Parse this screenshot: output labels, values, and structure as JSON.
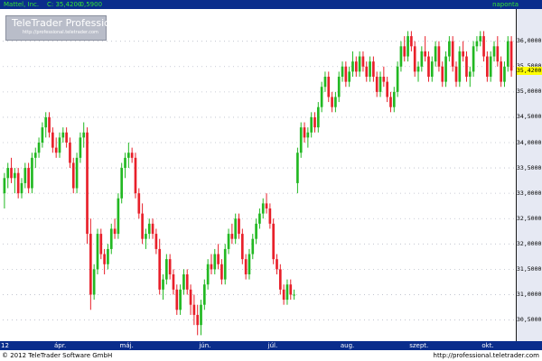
{
  "header": {
    "symbol": "Mattel, Inc.",
    "last": "C: 35,4200",
    "change": "-0,5900",
    "period": "naponta"
  },
  "logo": {
    "name": "TeleTrader Professional",
    "url": "http://professional.teletrader.com"
  },
  "footer": {
    "copyright": "© 2012 TeleTrader Software GmbH",
    "url": "http://professional.teletrader.com"
  },
  "colors": {
    "up": "#22b822",
    "down": "#e8202a",
    "doji": "#9ad6d6",
    "bar": "#0a2d8c",
    "axis_bg": "#e6e9f3",
    "grid": "#b9bdc9",
    "last_tag": "#ffff00"
  },
  "chart_data": {
    "type": "candlestick",
    "title": "Mattel, Inc.",
    "last_price_label": "35,4200",
    "y_axis": {
      "min": 30.1,
      "max": 36.6,
      "ticks": [
        30.5,
        31.0,
        31.5,
        32.0,
        32.5,
        33.0,
        33.5,
        34.0,
        34.5,
        35.0,
        35.5,
        36.0
      ],
      "tick_labels": [
        "30,5000",
        "31,0000",
        "31,5000",
        "32,0000",
        "32,5000",
        "33,0000",
        "33,5000",
        "34,0000",
        "34,5000",
        "35,0000",
        "35,5000",
        "36,0000"
      ]
    },
    "x_axis": {
      "labels": [
        "12",
        "ápr.",
        "máj.",
        "jún.",
        "júl.",
        "aug.",
        "szept.",
        "okt."
      ],
      "label_index": [
        0,
        16,
        35,
        58,
        78,
        99,
        119,
        140
      ]
    },
    "grid": true,
    "candles": [
      {
        "o": 33.0,
        "h": 33.4,
        "l": 32.7,
        "c": 33.3
      },
      {
        "o": 33.3,
        "h": 33.6,
        "l": 33.1,
        "c": 33.5
      },
      {
        "o": 33.5,
        "h": 33.7,
        "l": 33.2,
        "c": 33.3
      },
      {
        "o": 33.3,
        "h": 33.5,
        "l": 33.0,
        "c": 33.4
      },
      {
        "o": 33.4,
        "h": 33.5,
        "l": 32.9,
        "c": 33.0
      },
      {
        "o": 33.0,
        "h": 33.3,
        "l": 32.9,
        "c": 33.2
      },
      {
        "o": 33.2,
        "h": 33.6,
        "l": 33.1,
        "c": 33.5
      },
      {
        "o": 33.5,
        "h": 33.6,
        "l": 33.0,
        "c": 33.1
      },
      {
        "o": 33.1,
        "h": 33.8,
        "l": 33.0,
        "c": 33.7
      },
      {
        "o": 33.7,
        "h": 33.9,
        "l": 33.5,
        "c": 33.8
      },
      {
        "o": 33.8,
        "h": 34.1,
        "l": 33.7,
        "c": 34.0
      },
      {
        "o": 34.0,
        "h": 34.4,
        "l": 33.9,
        "c": 34.3
      },
      {
        "o": 34.3,
        "h": 34.6,
        "l": 34.1,
        "c": 34.5
      },
      {
        "o": 34.5,
        "h": 34.6,
        "l": 34.1,
        "c": 34.2
      },
      {
        "o": 34.2,
        "h": 34.3,
        "l": 33.8,
        "c": 33.9
      },
      {
        "o": 33.9,
        "h": 34.1,
        "l": 33.7,
        "c": 33.8
      },
      {
        "o": 33.8,
        "h": 34.2,
        "l": 33.7,
        "c": 34.1
      },
      {
        "o": 34.1,
        "h": 34.3,
        "l": 34.0,
        "c": 34.2
      },
      {
        "o": 34.2,
        "h": 34.3,
        "l": 33.9,
        "c": 34.0
      },
      {
        "o": 34.0,
        "h": 34.1,
        "l": 33.5,
        "c": 33.6
      },
      {
        "o": 33.6,
        "h": 33.7,
        "l": 33.0,
        "c": 33.1
      },
      {
        "o": 33.1,
        "h": 33.8,
        "l": 33.0,
        "c": 33.7
      },
      {
        "o": 33.7,
        "h": 34.2,
        "l": 33.6,
        "c": 34.1
      },
      {
        "o": 34.1,
        "h": 34.4,
        "l": 33.9,
        "c": 34.2
      },
      {
        "o": 34.2,
        "h": 34.3,
        "l": 32.0,
        "c": 32.2
      },
      {
        "o": 32.2,
        "h": 32.5,
        "l": 30.7,
        "c": 31.0
      },
      {
        "o": 31.0,
        "h": 31.6,
        "l": 30.9,
        "c": 31.5
      },
      {
        "o": 31.5,
        "h": 32.3,
        "l": 31.4,
        "c": 32.2
      },
      {
        "o": 32.2,
        "h": 32.3,
        "l": 31.7,
        "c": 31.8
      },
      {
        "o": 31.8,
        "h": 31.9,
        "l": 31.4,
        "c": 31.6
      },
      {
        "o": 31.6,
        "h": 32.0,
        "l": 31.5,
        "c": 31.9
      },
      {
        "o": 31.9,
        "h": 32.4,
        "l": 31.8,
        "c": 32.3
      },
      {
        "o": 32.3,
        "h": 32.5,
        "l": 32.1,
        "c": 32.2
      },
      {
        "o": 32.2,
        "h": 33.0,
        "l": 32.1,
        "c": 32.9
      },
      {
        "o": 32.9,
        "h": 33.6,
        "l": 32.8,
        "c": 33.5
      },
      {
        "o": 33.5,
        "h": 33.8,
        "l": 33.3,
        "c": 33.7
      },
      {
        "o": 33.7,
        "h": 34.0,
        "l": 33.5,
        "c": 33.8
      },
      {
        "o": 33.8,
        "h": 33.9,
        "l": 33.6,
        "c": 33.7
      },
      {
        "o": 33.7,
        "h": 33.8,
        "l": 32.9,
        "c": 33.0
      },
      {
        "o": 33.0,
        "h": 33.1,
        "l": 32.5,
        "c": 32.6
      },
      {
        "o": 32.6,
        "h": 32.8,
        "l": 32.0,
        "c": 32.1
      },
      {
        "o": 32.1,
        "h": 32.3,
        "l": 31.9,
        "c": 32.2
      },
      {
        "o": 32.2,
        "h": 32.5,
        "l": 32.1,
        "c": 32.4
      },
      {
        "o": 32.4,
        "h": 32.5,
        "l": 32.1,
        "c": 32.2
      },
      {
        "o": 32.2,
        "h": 32.3,
        "l": 31.8,
        "c": 31.9
      },
      {
        "o": 31.9,
        "h": 32.1,
        "l": 31.0,
        "c": 31.1
      },
      {
        "o": 31.1,
        "h": 31.4,
        "l": 30.9,
        "c": 31.3
      },
      {
        "o": 31.3,
        "h": 31.8,
        "l": 31.2,
        "c": 31.7
      },
      {
        "o": 31.7,
        "h": 31.8,
        "l": 31.3,
        "c": 31.4
      },
      {
        "o": 31.4,
        "h": 31.5,
        "l": 31.0,
        "c": 31.1
      },
      {
        "o": 31.1,
        "h": 31.2,
        "l": 30.6,
        "c": 30.7
      },
      {
        "o": 30.7,
        "h": 31.2,
        "l": 30.6,
        "c": 31.1
      },
      {
        "o": 31.1,
        "h": 31.5,
        "l": 31.0,
        "c": 31.4
      },
      {
        "o": 31.4,
        "h": 31.5,
        "l": 31.0,
        "c": 31.1
      },
      {
        "o": 31.1,
        "h": 31.2,
        "l": 30.6,
        "c": 30.8
      },
      {
        "o": 30.8,
        "h": 31.0,
        "l": 30.4,
        "c": 30.6
      },
      {
        "o": 30.6,
        "h": 30.8,
        "l": 30.2,
        "c": 30.4
      },
      {
        "o": 30.4,
        "h": 30.9,
        "l": 30.2,
        "c": 30.8
      },
      {
        "o": 30.8,
        "h": 31.3,
        "l": 30.7,
        "c": 31.2
      },
      {
        "o": 31.2,
        "h": 31.7,
        "l": 31.1,
        "c": 31.6
      },
      {
        "o": 31.6,
        "h": 31.8,
        "l": 31.4,
        "c": 31.5
      },
      {
        "o": 31.5,
        "h": 31.9,
        "l": 31.4,
        "c": 31.8
      },
      {
        "o": 31.8,
        "h": 32.0,
        "l": 31.5,
        "c": 31.6
      },
      {
        "o": 31.6,
        "h": 31.7,
        "l": 31.2,
        "c": 31.3
      },
      {
        "o": 31.3,
        "h": 32.0,
        "l": 31.2,
        "c": 31.9
      },
      {
        "o": 31.9,
        "h": 32.3,
        "l": 31.8,
        "c": 32.2
      },
      {
        "o": 32.2,
        "h": 32.4,
        "l": 32.0,
        "c": 32.1
      },
      {
        "o": 32.1,
        "h": 32.6,
        "l": 32.0,
        "c": 32.5
      },
      {
        "o": 32.5,
        "h": 32.6,
        "l": 32.1,
        "c": 32.2
      },
      {
        "o": 32.2,
        "h": 32.3,
        "l": 31.6,
        "c": 31.7
      },
      {
        "o": 31.7,
        "h": 31.8,
        "l": 31.3,
        "c": 31.4
      },
      {
        "o": 31.4,
        "h": 31.9,
        "l": 31.3,
        "c": 31.8
      },
      {
        "o": 31.8,
        "h": 32.2,
        "l": 31.7,
        "c": 32.1
      },
      {
        "o": 32.1,
        "h": 32.5,
        "l": 32.0,
        "c": 32.4
      },
      {
        "o": 32.4,
        "h": 32.7,
        "l": 32.3,
        "c": 32.6
      },
      {
        "o": 32.6,
        "h": 32.9,
        "l": 32.5,
        "c": 32.8
      },
      {
        "o": 32.8,
        "h": 33.0,
        "l": 32.6,
        "c": 32.7
      },
      {
        "o": 32.7,
        "h": 32.8,
        "l": 32.3,
        "c": 32.4
      },
      {
        "o": 32.4,
        "h": 32.5,
        "l": 31.6,
        "c": 31.7
      },
      {
        "o": 31.7,
        "h": 31.8,
        "l": 31.4,
        "c": 31.5
      },
      {
        "o": 31.5,
        "h": 31.6,
        "l": 31.0,
        "c": 31.1
      },
      {
        "o": 31.1,
        "h": 31.2,
        "l": 30.8,
        "c": 30.9
      },
      {
        "o": 30.9,
        "h": 31.3,
        "l": 30.8,
        "c": 31.2
      },
      {
        "o": 31.2,
        "h": 31.3,
        "l": 30.9,
        "c": 31.0
      },
      {
        "o": 31.0,
        "h": 31.1,
        "l": 30.9,
        "c": 31.0
      },
      {
        "o": 33.2,
        "h": 33.9,
        "l": 33.0,
        "c": 33.8
      },
      {
        "o": 33.8,
        "h": 34.4,
        "l": 33.7,
        "c": 34.3
      },
      {
        "o": 34.3,
        "h": 34.4,
        "l": 34.0,
        "c": 34.1
      },
      {
        "o": 34.1,
        "h": 34.3,
        "l": 33.9,
        "c": 34.2
      },
      {
        "o": 34.2,
        "h": 34.6,
        "l": 34.1,
        "c": 34.5
      },
      {
        "o": 34.5,
        "h": 34.6,
        "l": 34.2,
        "c": 34.3
      },
      {
        "o": 34.3,
        "h": 34.8,
        "l": 34.2,
        "c": 34.7
      },
      {
        "o": 34.7,
        "h": 35.2,
        "l": 34.6,
        "c": 35.1
      },
      {
        "o": 35.1,
        "h": 35.4,
        "l": 35.0,
        "c": 35.3
      },
      {
        "o": 35.3,
        "h": 35.4,
        "l": 34.8,
        "c": 34.9
      },
      {
        "o": 34.9,
        "h": 35.0,
        "l": 34.6,
        "c": 34.7
      },
      {
        "o": 34.7,
        "h": 35.0,
        "l": 34.6,
        "c": 34.9
      },
      {
        "o": 34.9,
        "h": 35.4,
        "l": 34.8,
        "c": 35.3
      },
      {
        "o": 35.3,
        "h": 35.6,
        "l": 35.2,
        "c": 35.5
      },
      {
        "o": 35.5,
        "h": 35.6,
        "l": 35.1,
        "c": 35.2
      },
      {
        "o": 35.2,
        "h": 35.5,
        "l": 35.1,
        "c": 35.4
      },
      {
        "o": 35.4,
        "h": 35.8,
        "l": 35.3,
        "c": 35.6
      },
      {
        "o": 35.6,
        "h": 35.7,
        "l": 35.3,
        "c": 35.4
      },
      {
        "o": 35.4,
        "h": 35.8,
        "l": 35.3,
        "c": 35.7
      },
      {
        "o": 35.7,
        "h": 35.8,
        "l": 35.4,
        "c": 35.5
      },
      {
        "o": 35.5,
        "h": 35.6,
        "l": 35.2,
        "c": 35.3
      },
      {
        "o": 35.3,
        "h": 35.7,
        "l": 35.2,
        "c": 35.6
      },
      {
        "o": 35.6,
        "h": 35.7,
        "l": 35.2,
        "c": 35.3
      },
      {
        "o": 35.3,
        "h": 35.4,
        "l": 34.9,
        "c": 35.0
      },
      {
        "o": 35.0,
        "h": 35.4,
        "l": 34.9,
        "c": 35.3
      },
      {
        "o": 35.3,
        "h": 35.5,
        "l": 35.1,
        "c": 35.2
      },
      {
        "o": 35.2,
        "h": 35.3,
        "l": 34.8,
        "c": 34.9
      },
      {
        "o": 34.9,
        "h": 35.0,
        "l": 34.6,
        "c": 34.7
      },
      {
        "o": 34.7,
        "h": 35.1,
        "l": 34.6,
        "c": 35.0
      },
      {
        "o": 35.0,
        "h": 35.6,
        "l": 34.9,
        "c": 35.5
      },
      {
        "o": 35.5,
        "h": 36.0,
        "l": 35.4,
        "c": 35.9
      },
      {
        "o": 35.9,
        "h": 36.1,
        "l": 35.6,
        "c": 35.7
      },
      {
        "o": 35.7,
        "h": 36.2,
        "l": 35.6,
        "c": 36.1
      },
      {
        "o": 36.1,
        "h": 36.2,
        "l": 35.8,
        "c": 35.9
      },
      {
        "o": 35.9,
        "h": 36.0,
        "l": 35.3,
        "c": 35.4
      },
      {
        "o": 35.4,
        "h": 35.6,
        "l": 35.2,
        "c": 35.5
      },
      {
        "o": 35.5,
        "h": 35.9,
        "l": 35.4,
        "c": 35.8
      },
      {
        "o": 35.8,
        "h": 36.1,
        "l": 35.6,
        "c": 35.7
      },
      {
        "o": 35.7,
        "h": 35.8,
        "l": 35.2,
        "c": 35.3
      },
      {
        "o": 35.3,
        "h": 35.7,
        "l": 35.2,
        "c": 35.6
      },
      {
        "o": 35.6,
        "h": 36.0,
        "l": 35.5,
        "c": 35.9
      },
      {
        "o": 35.9,
        "h": 36.0,
        "l": 35.4,
        "c": 35.5
      },
      {
        "o": 35.5,
        "h": 35.6,
        "l": 35.1,
        "c": 35.2
      },
      {
        "o": 35.2,
        "h": 35.8,
        "l": 35.1,
        "c": 35.7
      },
      {
        "o": 35.7,
        "h": 36.1,
        "l": 35.6,
        "c": 36.0
      },
      {
        "o": 36.0,
        "h": 36.1,
        "l": 35.4,
        "c": 35.5
      },
      {
        "o": 35.5,
        "h": 35.6,
        "l": 35.1,
        "c": 35.2
      },
      {
        "o": 35.2,
        "h": 35.9,
        "l": 35.1,
        "c": 35.8
      },
      {
        "o": 35.8,
        "h": 36.0,
        "l": 35.6,
        "c": 35.7
      },
      {
        "o": 35.7,
        "h": 35.8,
        "l": 35.2,
        "c": 35.3
      },
      {
        "o": 35.3,
        "h": 35.5,
        "l": 35.1,
        "c": 35.4
      },
      {
        "o": 35.4,
        "h": 36.0,
        "l": 35.3,
        "c": 35.9
      },
      {
        "o": 35.9,
        "h": 36.1,
        "l": 35.8,
        "c": 36.0
      },
      {
        "o": 36.0,
        "h": 36.2,
        "l": 35.9,
        "c": 36.1
      },
      {
        "o": 36.1,
        "h": 36.2,
        "l": 35.6,
        "c": 35.7
      },
      {
        "o": 35.7,
        "h": 35.8,
        "l": 35.2,
        "c": 35.3
      },
      {
        "o": 35.3,
        "h": 35.8,
        "l": 35.2,
        "c": 35.7
      },
      {
        "o": 35.7,
        "h": 36.0,
        "l": 35.6,
        "c": 35.9
      },
      {
        "o": 35.9,
        "h": 36.1,
        "l": 35.5,
        "c": 35.6
      },
      {
        "o": 35.6,
        "h": 35.7,
        "l": 35.1,
        "c": 35.2
      },
      {
        "o": 35.2,
        "h": 35.6,
        "l": 35.1,
        "c": 35.5
      },
      {
        "o": 35.5,
        "h": 36.1,
        "l": 35.4,
        "c": 36.0
      },
      {
        "o": 36.0,
        "h": 36.1,
        "l": 35.3,
        "c": 35.42
      }
    ]
  }
}
